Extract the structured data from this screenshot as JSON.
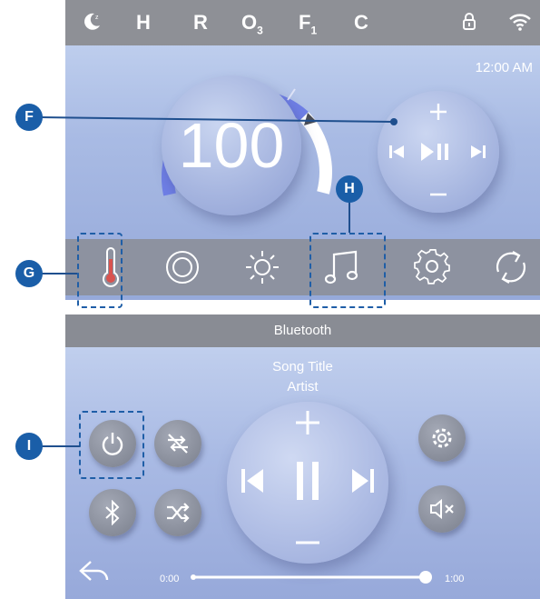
{
  "status_bar": {
    "icons": [
      "moon-icon",
      "lock-icon",
      "wifi-icon"
    ],
    "indicators": [
      {
        "label": "H",
        "sub": ""
      },
      {
        "label": "R",
        "sub": ""
      },
      {
        "label": "O",
        "sub": "3"
      },
      {
        "label": "F",
        "sub": "1"
      },
      {
        "label": "C",
        "sub": ""
      }
    ]
  },
  "main": {
    "clock": "12:00 AM",
    "temperature": "100",
    "mini_player_icons": [
      "plus-icon",
      "previous-icon",
      "play-pause-icon",
      "next-icon",
      "minus-icon"
    ]
  },
  "nav": {
    "items": [
      "thermometer-icon",
      "jets-icon",
      "light-icon",
      "music-icon",
      "settings-icon",
      "cycle-icon"
    ]
  },
  "callouts": {
    "f": "F",
    "g": "G",
    "h": "H",
    "i": "I"
  },
  "bluetooth": {
    "title": "Bluetooth",
    "song_title": "Song Title",
    "artist": "Artist",
    "time_start": "0:00",
    "time_end": "1:00",
    "progress": 1.0,
    "left_buttons": [
      "power-icon",
      "repeat-off-icon",
      "bluetooth-icon",
      "shuffle-icon"
    ],
    "right_buttons": [
      "settings-icon",
      "mute-icon"
    ],
    "back_icon": "back-icon"
  },
  "colors": {
    "accent": "#1a5ea8",
    "gauge": "#6f7fe6",
    "status_bar": "#8e9096",
    "nav_bar": "#8d92a0",
    "thermometer": "#d9534f"
  }
}
